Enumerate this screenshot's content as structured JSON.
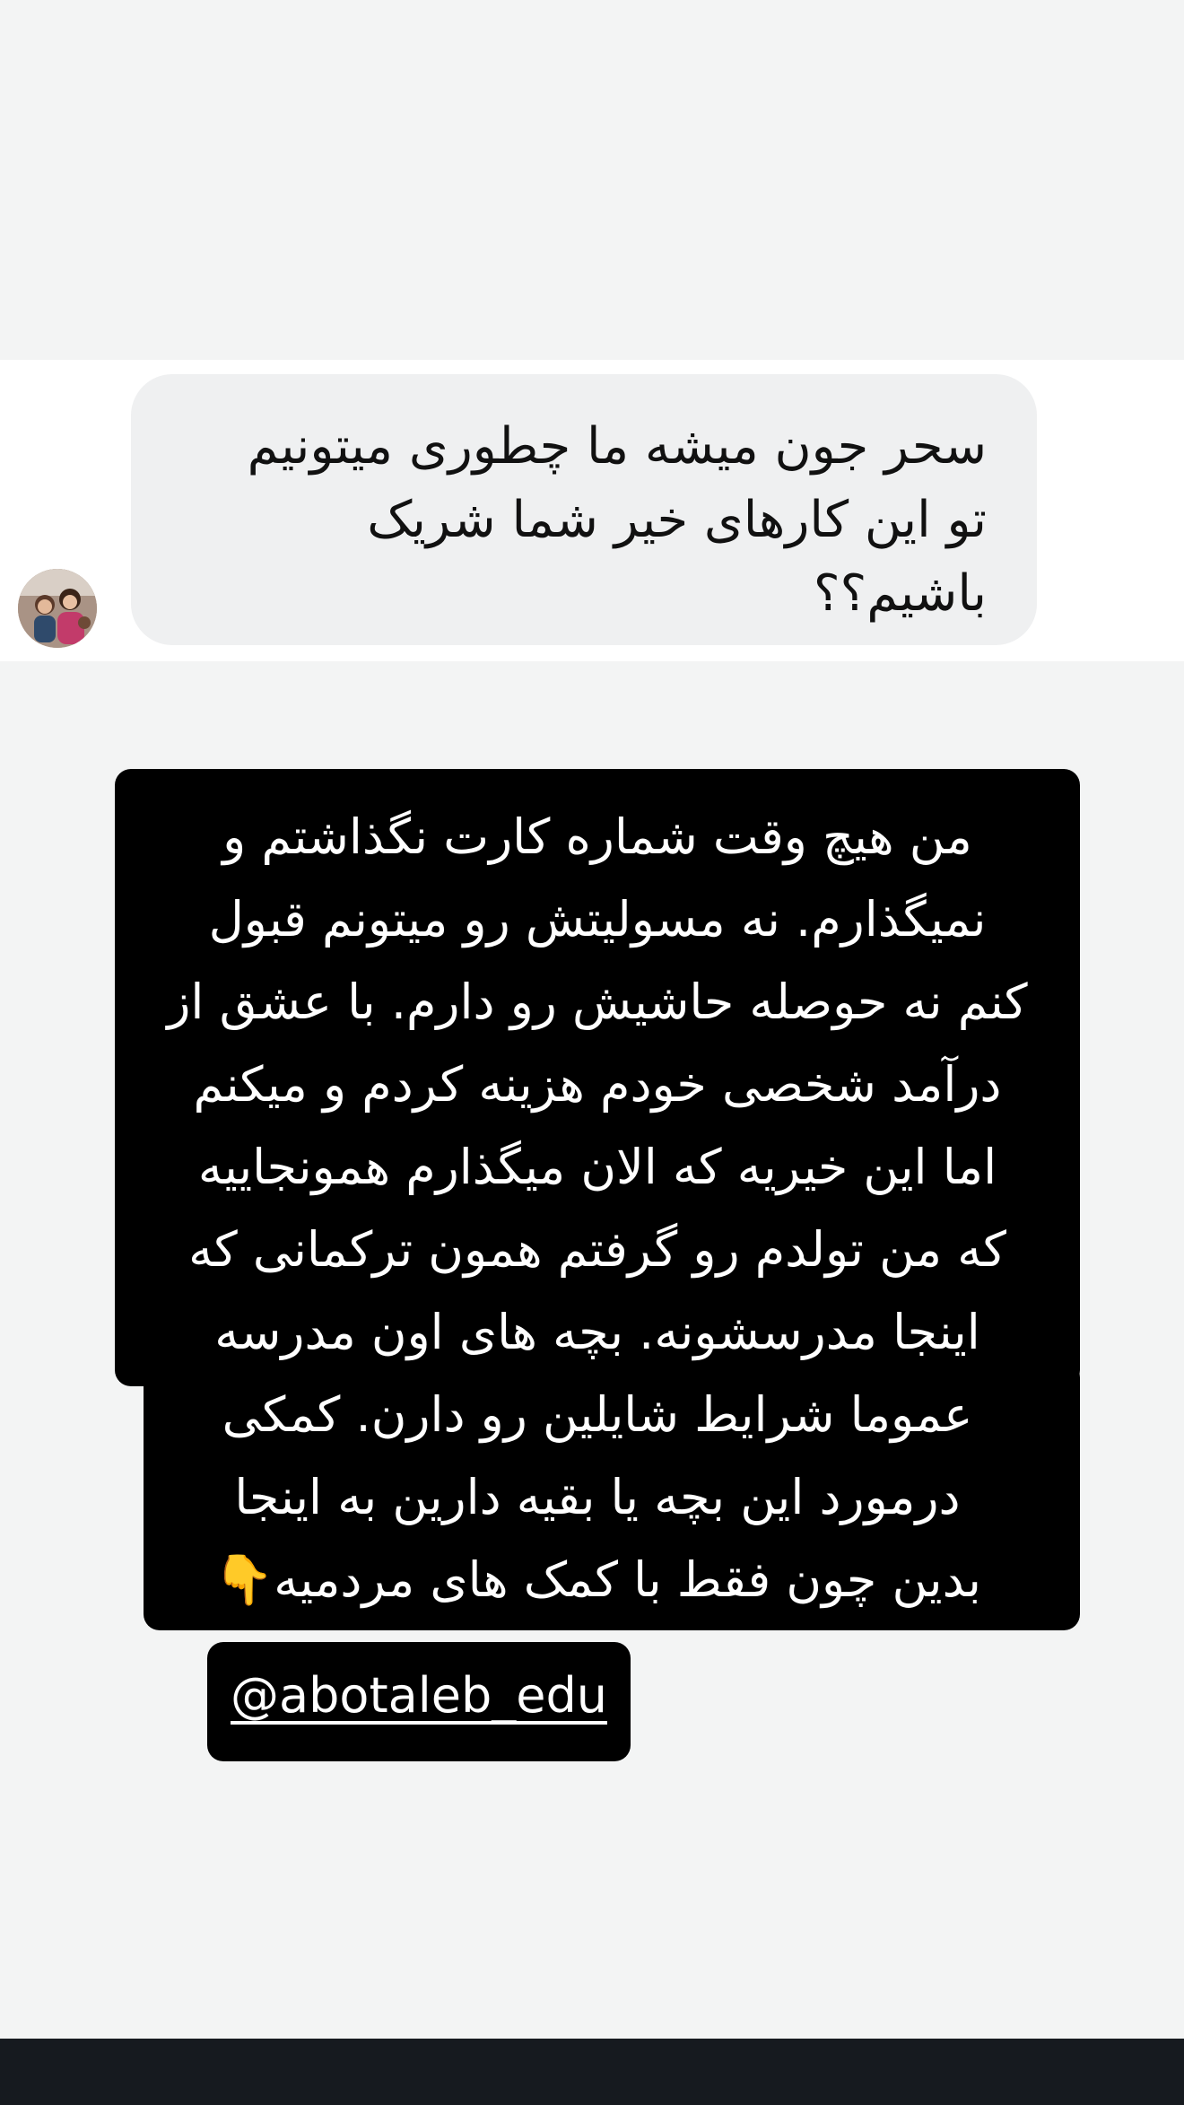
{
  "question": {
    "avatar_icon": "profile-photo",
    "lines": [
      "سحر جون میشه ما چطوری میتونیم",
      "تو این کارهای خیر شما شریک",
      "باشیم؟؟"
    ]
  },
  "answer": {
    "lines": [
      "من هیچ وقت شماره کارت نگذاشتم و",
      "نمیگذارم. نه مسولیتش رو میتونم قبول",
      "کنم نه حوصله حاشیش رو دارم. با عشق از",
      "درآمد شخصی خودم هزینه کردم و میکنم",
      "اما این خیریه که الان میگذارم همونجاییه",
      "که من تولدم رو گرفتم  همون ترکمانی که",
      "اینجا مدرسشونه. بچه های اون مدرسه",
      "عموما شرایط شایلین رو دارن. کمکی",
      "درمورد این بچه یا بقیه دارین به اینجا",
      "بدین چون فقط با کمک های مردمیه"
    ],
    "emoji": "👇",
    "emoji_icon": "pointing-down-hand-icon"
  },
  "mention": {
    "handle": "@abotaleb_edu"
  },
  "colors": {
    "background": "#f3f4f4",
    "bubble": "#eff0f1",
    "answer_bg": "#000000",
    "bottom_bar": "#161a1f"
  }
}
